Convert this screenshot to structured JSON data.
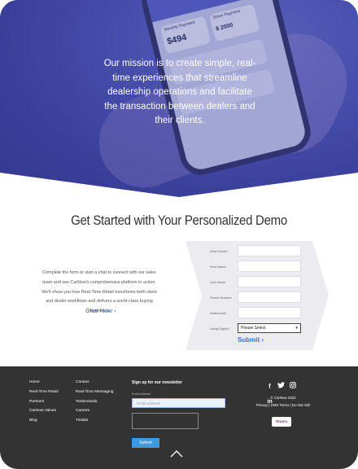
{
  "hero": {
    "mission": "Our mission is to create simple, real-time experiences that streamline dealership operations and facilitate the transaction between dealers and their clients.",
    "phone_screen": {
      "monthly_payment_label": "Monthly Payment",
      "monthly_payment_value": "$494",
      "down_payment_label": "Down Payment",
      "down_payment_value": "$ 2000"
    }
  },
  "demo": {
    "title": "Get Started with Your Personalized Demo",
    "intro": "Complete the form or start a chat to connect with our sales team and see CarNow's comprehensive platform in action. We'll show you how Real-Time Retail transforms both client and dealer workflows and delivers a world-class buying experience.",
    "chat_now": "Chat Now ›",
    "form": {
      "fields": [
        {
          "label": "Work Email*",
          "value": ""
        },
        {
          "label": "First Name",
          "value": ""
        },
        {
          "label": "Last Name",
          "value": ""
        },
        {
          "label": "Phone Number",
          "value": ""
        },
        {
          "label": "Dealership*",
          "value": ""
        }
      ],
      "select_label": "Using Digital*",
      "select_value": "Please Select",
      "submit": "Submit ›"
    }
  },
  "footer": {
    "col1": [
      "Home",
      "Real-Time Retail",
      "Partners",
      "CarNow Values",
      "Blog"
    ],
    "col2": [
      "Contact",
      "Real-Time Messaging",
      "Testimonials",
      "Careers",
      "Tintaks"
    ],
    "newsletter": {
      "title": "Sign up for our newsletter",
      "email_label": "Email Address*",
      "email_placeholder": "Email address",
      "submit": "Submit"
    },
    "social_icons": [
      "facebook-icon",
      "twitter-icon",
      "instagram-icon",
      "linkedin-icon"
    ],
    "social_glyphs": [
      "f",
      "ṭ",
      "◎",
      "in"
    ],
    "copyright": "© CarNow 2022",
    "legal": "Privacy  |  SMS Terms  |  Do Not Sell",
    "badge": "TRUSTe"
  },
  "colors": {
    "hero": "#4e55b3",
    "accent": "#3a6fd8",
    "footer": "#333333",
    "submit_button": "#3d9ae0"
  }
}
